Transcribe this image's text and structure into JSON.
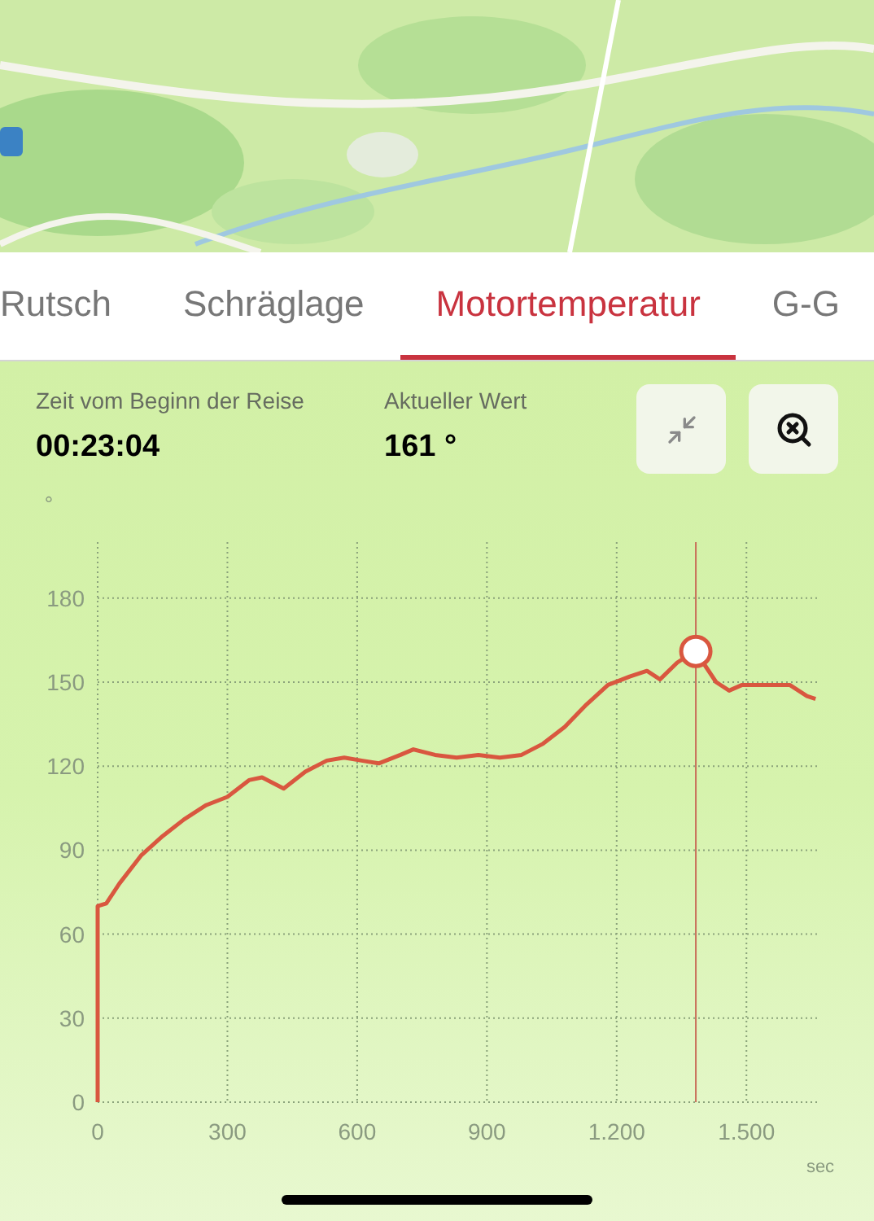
{
  "tabs": [
    {
      "label": "Rutsch",
      "selected": false
    },
    {
      "label": "Schräglage",
      "selected": false
    },
    {
      "label": "Motortemperatur",
      "selected": true
    },
    {
      "label": "G-G",
      "selected": false
    }
  ],
  "info": {
    "elapsed_label": "Zeit vom Beginn der Reise",
    "elapsed_value": "00:23:04",
    "current_label": "Aktueller Wert",
    "current_value": "161 °"
  },
  "chart": {
    "chart_data": {
      "type": "line",
      "xlabel": "sec",
      "ylabel": "°",
      "xlim": [
        0,
        1667
      ],
      "ylim": [
        0,
        200
      ],
      "xticks": [
        0,
        300,
        600,
        900,
        {
          "value": 1200,
          "label": "1.200"
        },
        {
          "value": 1500,
          "label": "1.500"
        }
      ],
      "yticks": [
        0,
        30,
        60,
        90,
        120,
        150,
        180
      ],
      "x": [
        0,
        0,
        20,
        50,
        100,
        150,
        200,
        250,
        300,
        350,
        380,
        430,
        480,
        530,
        570,
        610,
        650,
        700,
        730,
        780,
        830,
        880,
        930,
        980,
        1030,
        1080,
        1130,
        1180,
        1230,
        1270,
        1300,
        1340,
        1380,
        1400,
        1430,
        1460,
        1490,
        1550,
        1600,
        1640,
        1660
      ],
      "series": [
        {
          "color": "#d9573f",
          "values": [
            0,
            70,
            71,
            78,
            88,
            95,
            101,
            106,
            109,
            115,
            116,
            112,
            118,
            122,
            123,
            122,
            121,
            124,
            126,
            124,
            123,
            124,
            123,
            124,
            128,
            134,
            142,
            149,
            152,
            154,
            151,
            157,
            161,
            157,
            150,
            147,
            149,
            149,
            149,
            145,
            144
          ]
        }
      ],
      "grid": true,
      "ref_lines": [
        {
          "axis": "x",
          "value": 1383,
          "color": "#c8705a"
        }
      ]
    }
  }
}
